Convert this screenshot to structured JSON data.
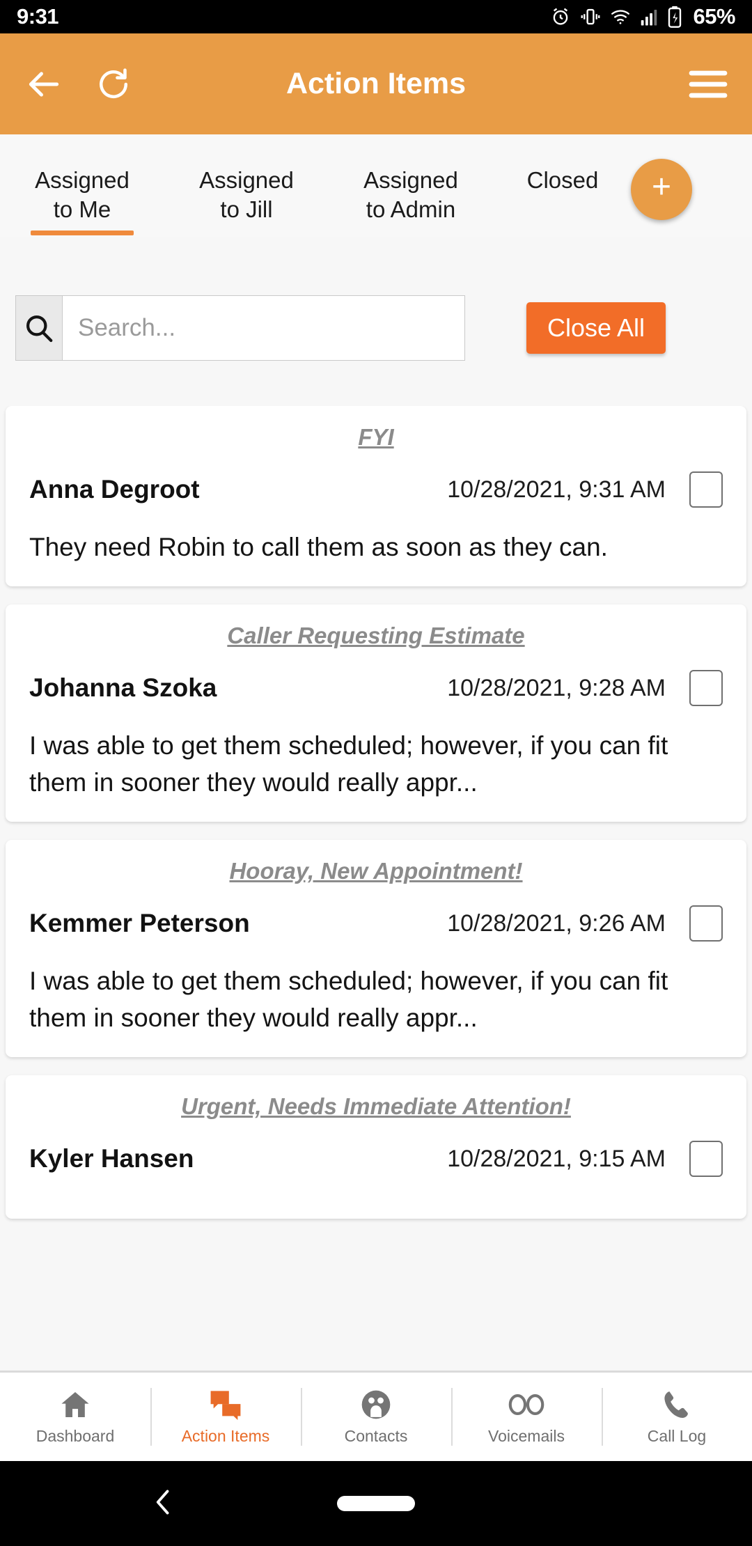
{
  "status_bar": {
    "time": "9:31",
    "battery_percent": "65%",
    "icons": [
      "alarm-icon",
      "vibrate-icon",
      "wifi-icon",
      "signal-icon",
      "battery-charging-icon"
    ]
  },
  "app_bar": {
    "title": "Action Items",
    "back_icon": "back-arrow-icon",
    "refresh_icon": "refresh-icon",
    "menu_icon": "hamburger-menu-icon",
    "background_color": "#e89c46"
  },
  "tabs": {
    "items": [
      {
        "line1": "Assigned",
        "line2": "to Me",
        "active": true
      },
      {
        "line1": "Assigned",
        "line2": "to Jill",
        "active": false
      },
      {
        "line1": "Assigned",
        "line2": "to Admin",
        "active": false
      },
      {
        "line1": "Closed",
        "line2": "",
        "active": false
      }
    ],
    "indicator_color": "#ef8a3c"
  },
  "fab": {
    "label": "+",
    "color": "#e89c46"
  },
  "search": {
    "placeholder": "Search...",
    "value": "",
    "icon": "search-icon"
  },
  "close_all_button": {
    "label": "Close All",
    "color": "#f26d28"
  },
  "action_items": [
    {
      "title": "FYI",
      "name": "Anna Degroot",
      "date": "10/28/2021, 9:31 AM",
      "message": "They need Robin to call them as soon as they can.",
      "checked": false
    },
    {
      "title": "Caller Requesting Estimate",
      "name": "Johanna Szoka",
      "date": "10/28/2021, 9:28 AM",
      "message": "I was able to get them scheduled; however, if you can fit them in sooner they would really appr...",
      "checked": false
    },
    {
      "title": "Hooray, New Appointment!",
      "name": "Kemmer Peterson",
      "date": "10/28/2021, 9:26 AM",
      "message": "I was able to get them scheduled; however, if you can fit them in sooner they would really appr...",
      "checked": false
    },
    {
      "title": "Urgent, Needs Immediate Attention!",
      "name": "Kyler Hansen",
      "date": "10/28/2021, 9:15 AM",
      "message": "",
      "checked": false
    }
  ],
  "bottom_nav": {
    "items": [
      {
        "label": "Dashboard",
        "icon": "home-icon",
        "active": false
      },
      {
        "label": "Action Items",
        "icon": "chat-bubble-icon",
        "active": true
      },
      {
        "label": "Contacts",
        "icon": "contacts-icon",
        "active": false
      },
      {
        "label": "Voicemails",
        "icon": "voicemail-icon",
        "active": false
      },
      {
        "label": "Call Log",
        "icon": "phone-icon",
        "active": false
      }
    ],
    "active_color": "#e86b28",
    "inactive_color": "#6f6f6f"
  },
  "system_nav": {
    "back_icon": "system-back-icon",
    "home_pill": "home-indicator-pill"
  }
}
